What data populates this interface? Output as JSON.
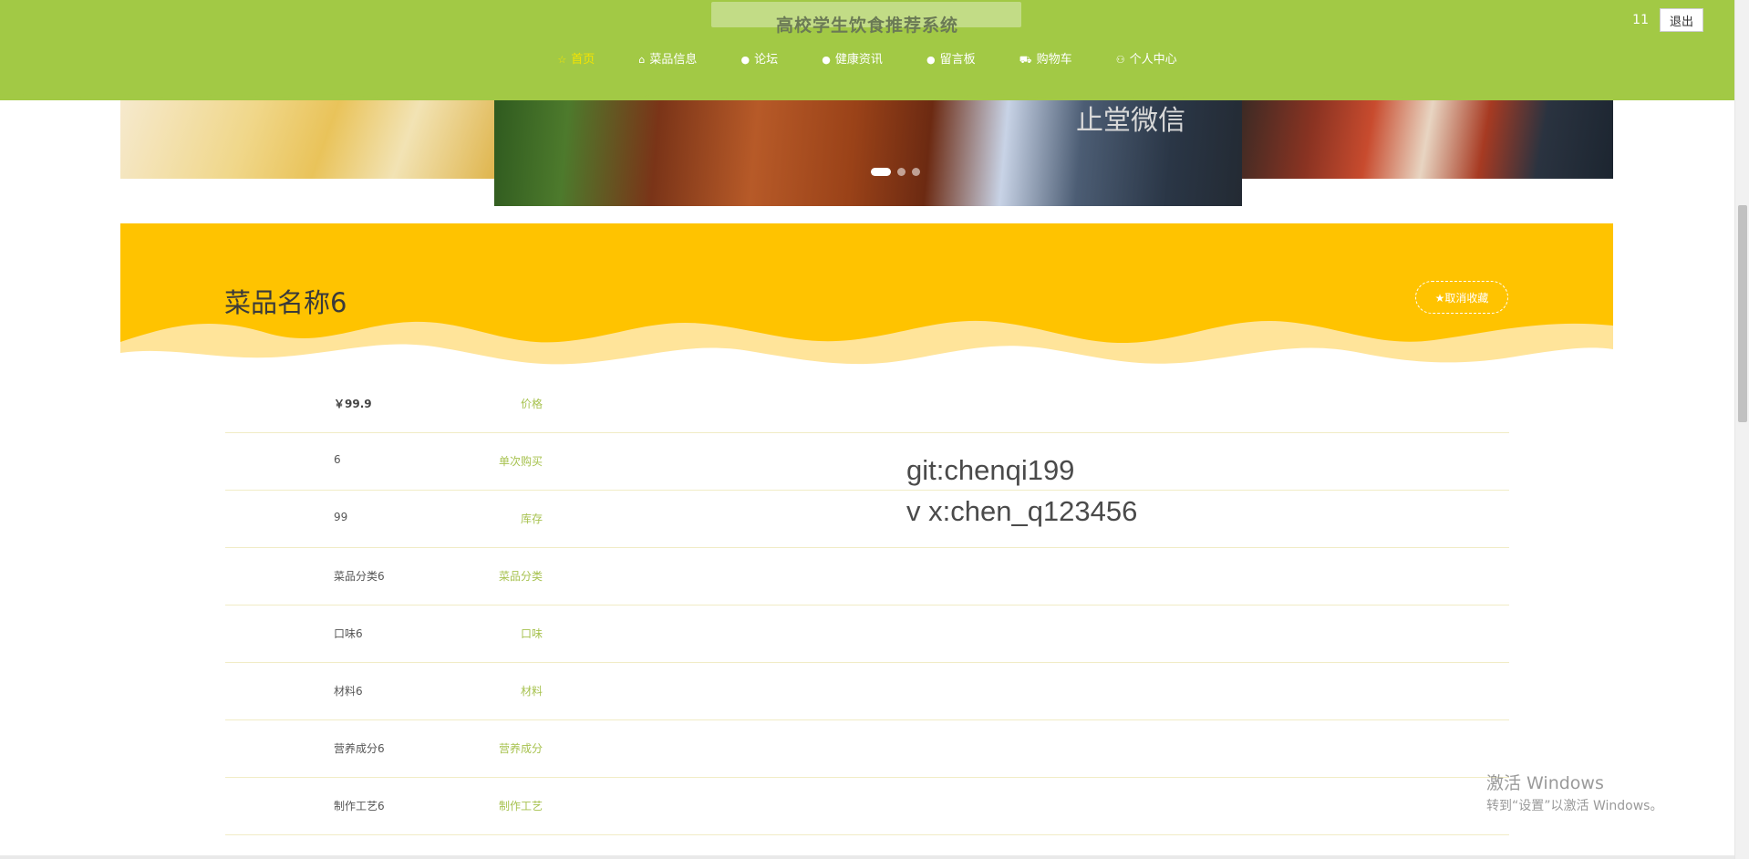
{
  "header": {
    "site_title": "高校学生饮食推荐系统",
    "user_name": "11",
    "logout_label": "退出",
    "background_color": "#a2c945",
    "nav": [
      {
        "label": "首页",
        "icon": "star-icon",
        "active": true
      },
      {
        "label": "菜品信息",
        "icon": "bag-icon",
        "active": false
      },
      {
        "label": "论坛",
        "icon": "circle-icon",
        "active": false
      },
      {
        "label": "健康资讯",
        "icon": "circle-icon",
        "active": false
      },
      {
        "label": "留言板",
        "icon": "circle-icon",
        "active": false
      },
      {
        "label": "购物车",
        "icon": "cart-icon",
        "active": false
      },
      {
        "label": "个人中心",
        "icon": "user-icon",
        "active": false
      }
    ]
  },
  "carousel": {
    "active_index": 0,
    "slide_count": 3,
    "center_text": "止堂微信"
  },
  "detail": {
    "title": "菜品名称6",
    "favorite_label": "★取消收藏",
    "band_color": "#ffc300",
    "rows": [
      {
        "label": "价格",
        "value": "￥99.9"
      },
      {
        "label": "单次购买",
        "value": "6"
      },
      {
        "label": "库存",
        "value": "99"
      },
      {
        "label": "菜品分类",
        "value": "菜品分类6"
      },
      {
        "label": "口味",
        "value": "口味6"
      },
      {
        "label": "材料",
        "value": "材料6"
      },
      {
        "label": "营养成分",
        "value": "营养成分6"
      },
      {
        "label": "制作工艺",
        "value": "制作工艺6"
      }
    ]
  },
  "overlay": {
    "line1": "git:chenqi199",
    "line2": "v x:chen_q123456"
  },
  "windows_activation": {
    "title": "激活 Windows",
    "subtitle": "转到“设置”以激活 Windows。"
  }
}
